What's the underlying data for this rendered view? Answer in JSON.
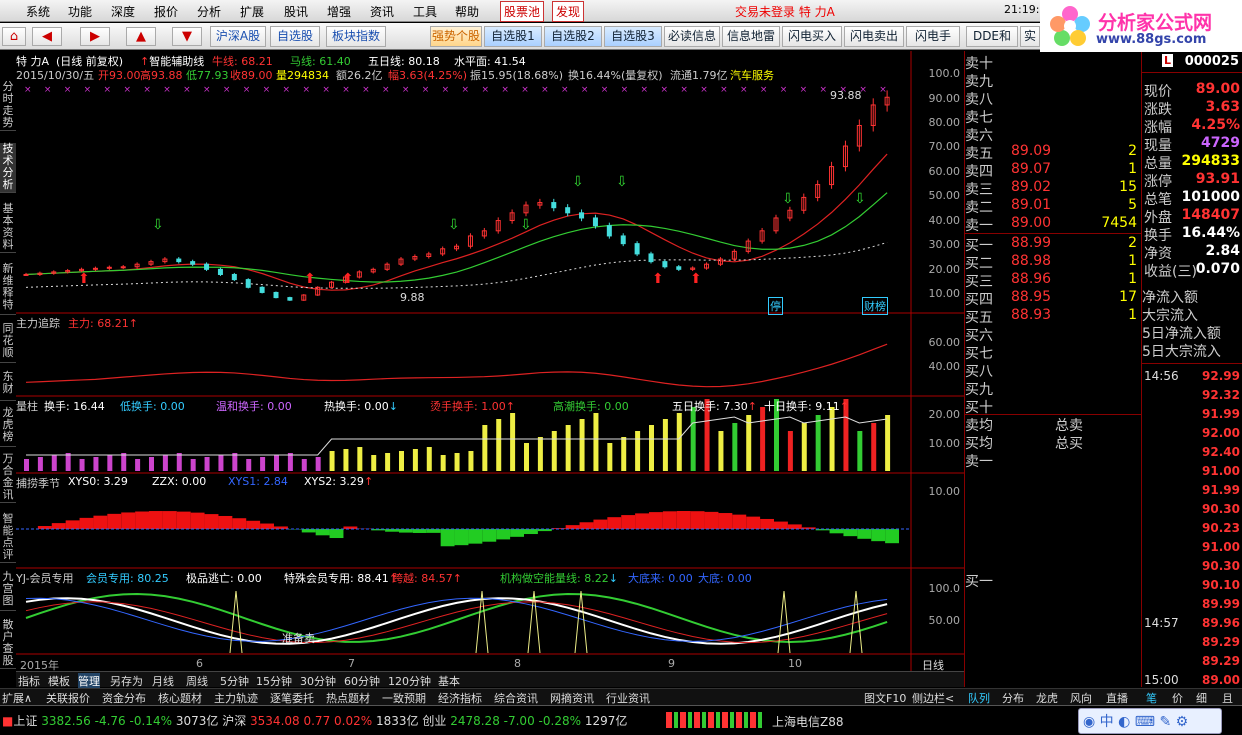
{
  "menu": [
    "系统",
    "功能",
    "深度",
    "报价",
    "分析",
    "扩展",
    "股讯",
    "增强",
    "资讯",
    "工具",
    "帮助",
    "股票池",
    "发现"
  ],
  "login_status": "交易未登录  特 力A",
  "clock": "21:19:2",
  "logo": {
    "line1": "分析家公式网",
    "line2": "www.88gs.com"
  },
  "toolbar": {
    "buttons": [
      "沪深A股",
      "自选股",
      "板块指数",
      "强势个股",
      "自选股1",
      "自选股2",
      "自选股3",
      "必读信息",
      "信息地雷",
      "闪电买入",
      "闪电卖出",
      "闪电手",
      "DDE和",
      "实"
    ]
  },
  "lefttabs": [
    "分时走势",
    "技术分析",
    "基本资料",
    "新维释特",
    "同花顺",
    "东财",
    "龙虎榜",
    "万合金讯",
    "智能点评",
    "九宫图",
    "散户查股"
  ],
  "chart": {
    "header1": {
      "name": "特 力A",
      "mode": "(日线 前复权)",
      "assist": "智能辅助线",
      "niu": "牛线: 68.21",
      "ma": "马线: 61.40",
      "wu": "五日线: 80.18",
      "level": "水平面: 41.54"
    },
    "header2": {
      "date": "2015/10/30/五",
      "open": "开93.00",
      "high": "高93.88",
      "low": "低77.93",
      "close": "收89.00",
      "vol": "量294834",
      "amt": "额26.2亿",
      "amp": "幅3.63(4.25%)",
      "zhen": "振15.95(18.68%)",
      "huan": "换16.44%(量复权)",
      "float": "流通1.79亿",
      "sector": "汽车服务"
    },
    "price_axis": [
      "100.0",
      "90.00",
      "80.00",
      "70.00",
      "60.00",
      "50.00",
      "40.00",
      "30.00",
      "20.00",
      "10.00"
    ],
    "high_label": "93.88",
    "low_label": "9.88",
    "badges": [
      "停",
      "财榜"
    ],
    "p2": {
      "title": "主力追踪",
      "val": "主力: 68.21",
      "axis": [
        "60.00",
        "40.00"
      ]
    },
    "p3": {
      "title": "量柱",
      "h1": "换手: 16.44",
      "h2": "低换手: 0.00",
      "h3": "温和换手: 0.00",
      "h4": "热换手: 0.00",
      "h5": "烫手换手: 1.00",
      "h6": "高潮换手: 0.00",
      "h7": "五日换手: 7.30",
      "h8": "十日换手: 9.11",
      "axis": [
        "20.00",
        "10.00"
      ]
    },
    "p4": {
      "title": "捕捞季节",
      "x0": "XYS0: 3.29",
      "zzx": "ZZX: 0.00",
      "x1": "XYS1: 2.84",
      "x2": "XYS2: 3.29",
      "axis": [
        "10.00"
      ]
    },
    "p5": {
      "title": "YJ-会员专用",
      "a": "会员专用: 80.25",
      "b": "极品逃亡: 0.00",
      "c": "特殊会员专用: 88.41",
      "d": "跨越: 84.57",
      "e": "机构做空能量线: 8.22",
      "f": "大底来: 0.00",
      "g": "大底: 0.00",
      "note": "准备卖",
      "axis": [
        "100.0",
        "50.00"
      ]
    },
    "xaxis": [
      "2015年",
      "6",
      "7",
      "8",
      "9",
      "10"
    ],
    "period": "日线"
  },
  "chart_data": {
    "type": "candlestick",
    "period": "日线",
    "last": {
      "open": 93.0,
      "high": 93.88,
      "low": 77.93,
      "close": 89.0
    },
    "ylim": [
      5,
      100
    ],
    "closes": [
      20,
      20.5,
      21,
      21.5,
      22,
      22.4,
      22.8,
      23,
      24,
      25,
      26,
      25,
      24,
      22,
      20,
      18,
      15,
      13,
      11,
      10,
      12,
      15,
      17,
      19,
      21,
      22,
      24,
      26,
      27,
      28,
      30,
      31,
      35,
      37,
      41,
      44,
      47,
      48,
      46,
      44,
      42,
      39,
      35,
      32,
      28,
      25,
      23,
      22,
      22.5,
      24,
      26,
      29,
      33,
      37,
      42,
      45,
      50,
      55,
      62,
      70,
      78,
      86,
      89
    ]
  },
  "book": {
    "sell": [
      {
        "n": "卖十",
        "p": "",
        "v": ""
      },
      {
        "n": "卖九",
        "p": "",
        "v": ""
      },
      {
        "n": "卖八",
        "p": "",
        "v": ""
      },
      {
        "n": "卖七",
        "p": "",
        "v": ""
      },
      {
        "n": "卖六",
        "p": "",
        "v": ""
      },
      {
        "n": "卖五",
        "p": "89.09",
        "v": "2"
      },
      {
        "n": "卖四",
        "p": "89.07",
        "v": "1"
      },
      {
        "n": "卖三",
        "p": "89.02",
        "v": "15"
      },
      {
        "n": "卖二",
        "p": "89.01",
        "v": "5"
      },
      {
        "n": "卖一",
        "p": "89.00",
        "v": "7454"
      }
    ],
    "buy": [
      {
        "n": "买一",
        "p": "88.99",
        "v": "2"
      },
      {
        "n": "买二",
        "p": "88.98",
        "v": "1"
      },
      {
        "n": "买三",
        "p": "88.96",
        "v": "1"
      },
      {
        "n": "买四",
        "p": "88.95",
        "v": "17"
      },
      {
        "n": "买五",
        "p": "88.93",
        "v": "1"
      },
      {
        "n": "买六",
        "p": "",
        "v": ""
      },
      {
        "n": "买七",
        "p": "",
        "v": ""
      },
      {
        "n": "买八",
        "p": "",
        "v": ""
      },
      {
        "n": "买九",
        "p": "",
        "v": ""
      },
      {
        "n": "买十",
        "p": "",
        "v": ""
      }
    ],
    "avg_sell": "卖均",
    "avg_buy": "买均",
    "total_sell": "总卖",
    "total_buy": "总买",
    "s1": "卖一",
    "b1": "买一"
  },
  "quote": {
    "code": "000025",
    "badge": "L",
    "rows": [
      {
        "k": "现价",
        "v": "89.00",
        "c": "#f33"
      },
      {
        "k": "涨跌",
        "v": "3.63",
        "c": "#f33"
      },
      {
        "k": "涨幅",
        "v": "4.25%",
        "c": "#f33"
      },
      {
        "k": "现量",
        "v": "4729",
        "c": "#c6f"
      },
      {
        "k": "总量",
        "v": "294833",
        "c": "#ff0"
      },
      {
        "k": "涨停",
        "v": "93.91",
        "c": "#f33"
      },
      {
        "k": "总笔",
        "v": "101000",
        "c": "#fff"
      },
      {
        "k": "外盘",
        "v": "148407",
        "c": "#f33"
      },
      {
        "k": "换手",
        "v": "16.44%",
        "c": "#fff"
      },
      {
        "k": "净资",
        "v": "2.84",
        "c": "#fff"
      },
      {
        "k": "收益(三)",
        "v": "0.070",
        "c": "#fff"
      }
    ],
    "flows": [
      "净流入额",
      "大宗流入",
      "5日净流入额",
      "5日大宗流入"
    ],
    "ticks": [
      {
        "t": "14:56",
        "v": "92.99"
      },
      {
        "t": "",
        "v": "92.32"
      },
      {
        "t": "",
        "v": "91.99"
      },
      {
        "t": "",
        "v": "92.00"
      },
      {
        "t": "",
        "v": "92.40"
      },
      {
        "t": "",
        "v": "91.00"
      },
      {
        "t": "",
        "v": "91.99"
      },
      {
        "t": "",
        "v": "90.30"
      },
      {
        "t": "",
        "v": "90.23"
      },
      {
        "t": "",
        "v": "91.00"
      },
      {
        "t": "",
        "v": "90.30"
      },
      {
        "t": "",
        "v": "90.10"
      },
      {
        "t": "",
        "v": "89.99"
      },
      {
        "t": "14:57",
        "v": "89.96"
      },
      {
        "t": "",
        "v": "89.29"
      },
      {
        "t": "",
        "v": "89.29"
      },
      {
        "t": "15:00",
        "v": "89.00"
      }
    ]
  },
  "bottom1": [
    "指标",
    "模板",
    "管理",
    "另存为",
    "月线",
    "周线",
    "5分钟",
    "15分钟",
    "30分钟",
    "60分钟",
    "120分钟",
    "基本"
  ],
  "bottom2": [
    "扩展∧",
    "关联报价",
    "资金分布",
    "核心题材",
    "主力轨迹",
    "逐笔委托",
    "热点题材",
    "一致预期",
    "经济指标",
    "综合资讯",
    "网摘资讯",
    "行业资讯",
    "图文F10",
    "侧边栏<",
    "队列",
    "分布",
    "龙虎",
    "风向",
    "直播",
    "笔",
    "价",
    "细",
    "且"
  ],
  "status": {
    "sh": "上证",
    "sh_v": "3382.56",
    "sh_c": "-4.76",
    "sh_p": "-0.14%",
    "sh_a": "3073亿",
    "sz": "沪深",
    "sz_v": "3534.08",
    "sz_c": "0.77",
    "sz_p": "0.02%",
    "sz_a": "1833亿",
    "cy": "创业",
    "cy_v": "2478.28",
    "cy_c": "-7.00",
    "cy_p": "-0.28%",
    "cy_a": "1297亿",
    "net": "上海电信Z88"
  },
  "colors": {
    "up": "#ff3333",
    "down": "#44dddd",
    "bg": "#000000",
    "menu_bg": "#e8e8e8"
  }
}
